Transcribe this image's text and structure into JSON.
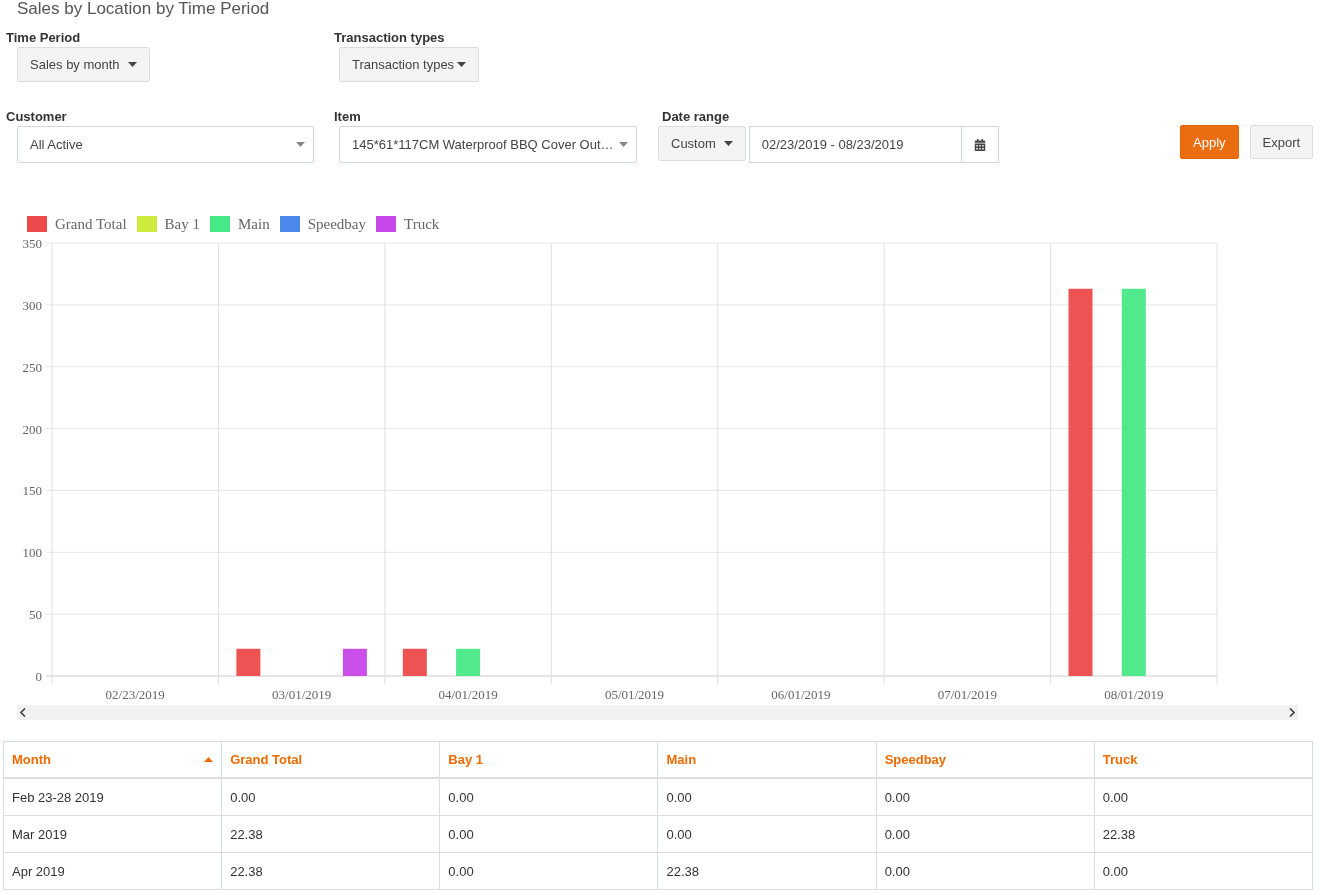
{
  "page_title": "Sales by Location by Time Period",
  "time_period": {
    "label": "Time Period",
    "value": "Sales by month"
  },
  "transaction_types": {
    "label": "Transaction types",
    "value": "Transaction types"
  },
  "customer": {
    "label": "Customer",
    "value": "All Active"
  },
  "item": {
    "label": "Item",
    "value": "145*61*117CM Waterproof BBQ Cover Out…"
  },
  "date_range": {
    "label": "Date range",
    "preset": "Custom",
    "value": "02/23/2019 - 08/23/2019"
  },
  "buttons": [
    {
      "label": "Apply",
      "kind": "primary"
    },
    {
      "label": "Export",
      "kind": "default"
    }
  ],
  "chart_data": {
    "type": "bar",
    "grid": true,
    "categories": [
      "02/23/2019",
      "03/01/2019",
      "04/01/2019",
      "05/01/2019",
      "06/01/2019",
      "07/01/2019",
      "08/01/2019"
    ],
    "ylim": [
      0,
      350
    ],
    "yticks": [
      0,
      50,
      100,
      150,
      200,
      250,
      300,
      350
    ],
    "series": [
      {
        "name": "Grand Total",
        "color": "#ec4a4a",
        "values": [
          0,
          22,
          22,
          0,
          0,
          0,
          313
        ]
      },
      {
        "name": "Bay 1",
        "color": "#cdea3e",
        "values": [
          0,
          0,
          0,
          0,
          0,
          0,
          0
        ]
      },
      {
        "name": "Main",
        "color": "#47e987",
        "values": [
          0,
          0,
          22,
          0,
          0,
          0,
          313
        ]
      },
      {
        "name": "Speedbay",
        "color": "#4a88ea",
        "values": [
          0,
          0,
          0,
          0,
          0,
          0,
          0
        ]
      },
      {
        "name": "Truck",
        "color": "#c847e9",
        "values": [
          0,
          22,
          0,
          0,
          0,
          0,
          0
        ]
      }
    ]
  },
  "table": {
    "columns": [
      {
        "label": "Month",
        "sorted": true
      },
      {
        "label": "Grand Total",
        "sorted": false
      },
      {
        "label": "Bay 1",
        "sorted": false
      },
      {
        "label": "Main",
        "sorted": false
      },
      {
        "label": "Speedbay",
        "sorted": false
      },
      {
        "label": "Truck",
        "sorted": false
      }
    ],
    "rows": [
      [
        "Feb 23-28 2019",
        "0.00",
        "0.00",
        "0.00",
        "0.00",
        "0.00"
      ],
      [
        "Mar 2019",
        "22.38",
        "0.00",
        "0.00",
        "0.00",
        "22.38"
      ],
      [
        "Apr 2019",
        "22.38",
        "0.00",
        "22.38",
        "0.00",
        "0.00"
      ]
    ]
  }
}
